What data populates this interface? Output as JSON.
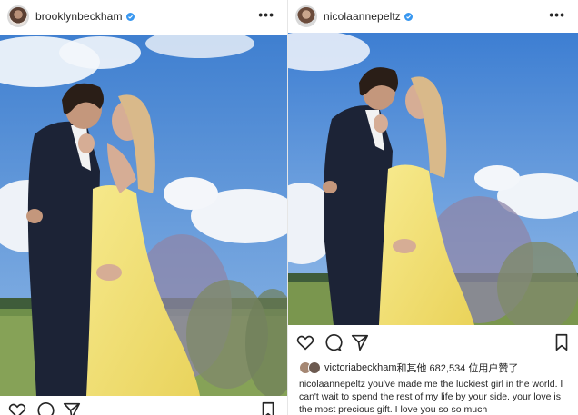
{
  "left_post": {
    "username": "brooklynbeckham",
    "more_label": "•••"
  },
  "right_post": {
    "username": "nicolaannepeltz",
    "more_label": "•••",
    "likes": {
      "liker": "victoriabeckham",
      "text": "和其他 682,534 位用户赞了"
    },
    "caption": {
      "author": "nicolaannepeltz",
      "text": "you've made me the luckiest girl in the world. I can't wait to spend the rest of my life by your side. your love is the most precious gift. I love you so so much"
    }
  },
  "icons": [
    "verified-badge-icon",
    "heart-icon",
    "comment-icon",
    "share-icon",
    "bookmark-icon",
    "user-tag-icon"
  ],
  "colors": {
    "verified": "#3897f0",
    "text": "#262626",
    "sky": "#4a86d0",
    "dress": "#f2e37a"
  }
}
